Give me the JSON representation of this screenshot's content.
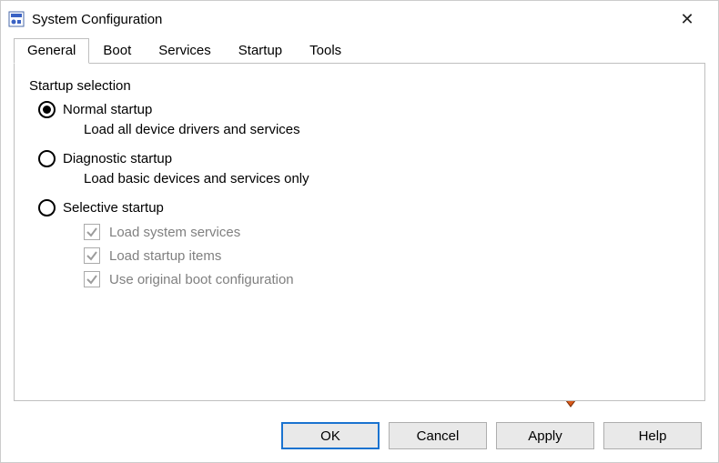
{
  "window": {
    "title": "System Configuration"
  },
  "tabs": {
    "t0": "General",
    "t1": "Boot",
    "t2": "Services",
    "t3": "Startup",
    "t4": "Tools"
  },
  "group": {
    "label": "Startup selection",
    "opt_normal": {
      "label": "Normal startup",
      "desc": "Load all device drivers and services"
    },
    "opt_diag": {
      "label": "Diagnostic startup",
      "desc": "Load basic devices and services only"
    },
    "opt_selective": {
      "label": "Selective startup",
      "chk1": "Load system services",
      "chk2": "Load startup items",
      "chk3": "Use original boot configuration"
    }
  },
  "buttons": {
    "ok": "OK",
    "cancel": "Cancel",
    "apply": "Apply",
    "help": "Help"
  }
}
